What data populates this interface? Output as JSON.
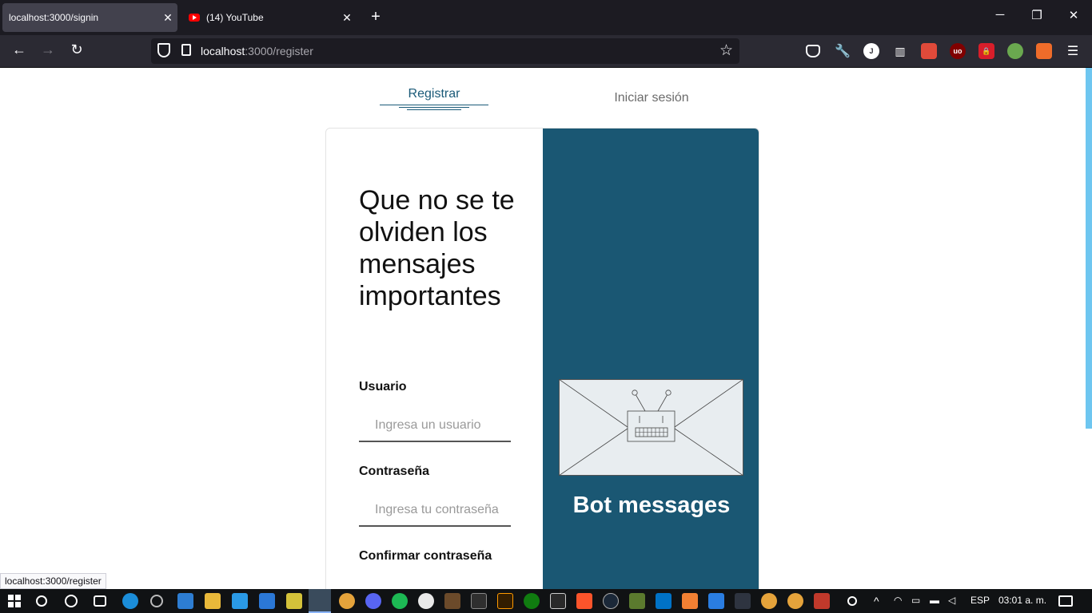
{
  "browser": {
    "tabs": [
      {
        "label": "localhost:3000/signin",
        "active": true
      },
      {
        "label": "(14) YouTube",
        "active": false
      }
    ],
    "url_host": "localhost",
    "url_rest": ":3000/register",
    "status_url": "localhost:3000/register"
  },
  "page": {
    "nav": {
      "register": "Registrar",
      "login": "Iniciar sesión"
    },
    "form": {
      "headline": "Que no se te olviden los mensajes importantes",
      "username_label": "Usuario",
      "username_placeholder": "Ingresa un usuario",
      "password_label": "Contraseña",
      "password_placeholder": "Ingresa tu contraseña",
      "confirm_label": "Confirmar contraseña"
    },
    "hero": {
      "title": "Bot messages"
    },
    "colors": {
      "accent": "#1a5773",
      "tab_active": "#1a5a78"
    }
  },
  "taskbar": {
    "language": "ESP",
    "time": "03:01 a. m."
  }
}
